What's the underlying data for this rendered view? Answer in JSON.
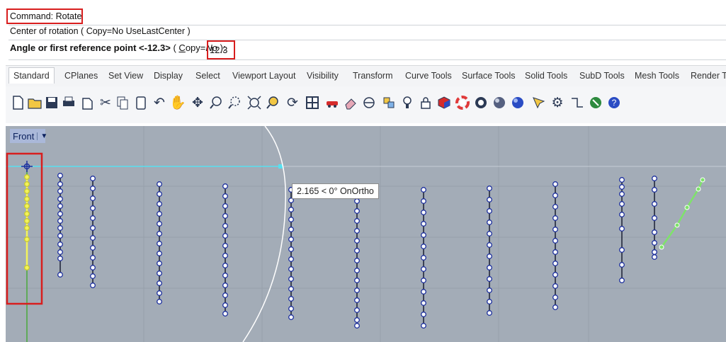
{
  "command": {
    "history_line": "Command: Rotate",
    "prompt_line": "Center of rotation ( Copy=No  UseLastCenter )",
    "active_prompt_label": "Angle or first reference point <-12.3>",
    "active_prompt_option_pre": " ( ",
    "active_prompt_option_c": "C",
    "active_prompt_option_rest": "opy=",
    "active_prompt_option_val": "No",
    "active_prompt_option_end": " ): ",
    "input_value": "12.3"
  },
  "tabs": [
    "Standard",
    "CPlanes",
    "Set View",
    "Display",
    "Select",
    "Viewport Layout",
    "Visibility",
    "Transform",
    "Curve Tools",
    "Surface Tools",
    "Solid Tools",
    "SubD Tools",
    "Mesh Tools",
    "Render To"
  ],
  "active_tab": "Standard",
  "toolbar_icons": [
    "new-file-icon",
    "open-folder-icon",
    "save-icon",
    "print-icon",
    "import-icon",
    "cut-icon",
    "copy-icon",
    "paste-icon",
    "undo-icon",
    "pan-icon",
    "rotate-view-icon",
    "zoom-icon",
    "zoom-window-icon",
    "zoom-extents-icon",
    "zoom-selected-icon",
    "rotate-icon",
    "four-viewports-icon",
    "car-icon",
    "eraser-icon",
    "layer-icon",
    "properties-icon",
    "light-icon",
    "lock-icon",
    "shaded-mode-icon",
    "color-wheel-icon",
    "circle-toggle-icon",
    "sphere-icon",
    "render-sphere-icon",
    "select-icon",
    "settings-gear-icon",
    "dimensions-icon",
    "globe-icon",
    "help-icon"
  ],
  "viewport": {
    "name": "Front",
    "tooltip": "2.165 < 0° OnOrtho"
  },
  "colors": {
    "highlight_box": "#d81e1e",
    "viewport_bg": "#a3acb7",
    "point_outline": "#1c2f9e",
    "selected_points": "#f3f35a",
    "green_curve": "#7ee36a",
    "cyan_line": "#58e0f0"
  }
}
